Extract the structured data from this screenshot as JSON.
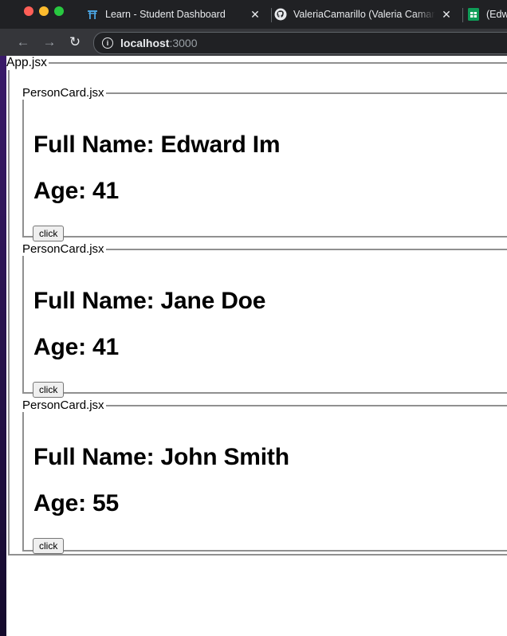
{
  "browser": {
    "tabs": [
      {
        "title": "Learn - Student Dashboard",
        "icon": "learn-torii-icon",
        "close": "✕"
      },
      {
        "title": "ValeriaCamarillo (Valeria Camarillo)",
        "icon": "github-icon",
        "close": "✕"
      },
      {
        "title": "(Edw",
        "icon": "google-sheets-icon"
      }
    ],
    "address": {
      "host": "localhost",
      "port": ":3000"
    },
    "nav": {
      "back": "←",
      "forward": "→",
      "reload": "↻",
      "info": "i"
    }
  },
  "app": {
    "legend": "App.jsx",
    "cards": [
      {
        "legend": "PersonCard.jsx",
        "name": "Full Name: Edward Im",
        "age": "Age: 41",
        "button": "click"
      },
      {
        "legend": "PersonCard.jsx",
        "name": "Full Name: Jane Doe",
        "age": "Age: 41",
        "button": "click"
      },
      {
        "legend": "PersonCard.jsx",
        "name": "Full Name: John Smith",
        "age": "Age: 55",
        "button": "click"
      }
    ]
  },
  "colors": {
    "tabbar": "#202124",
    "toolbar": "#35363a",
    "page_background": "#ffffff",
    "fieldset_border": "#909090"
  }
}
